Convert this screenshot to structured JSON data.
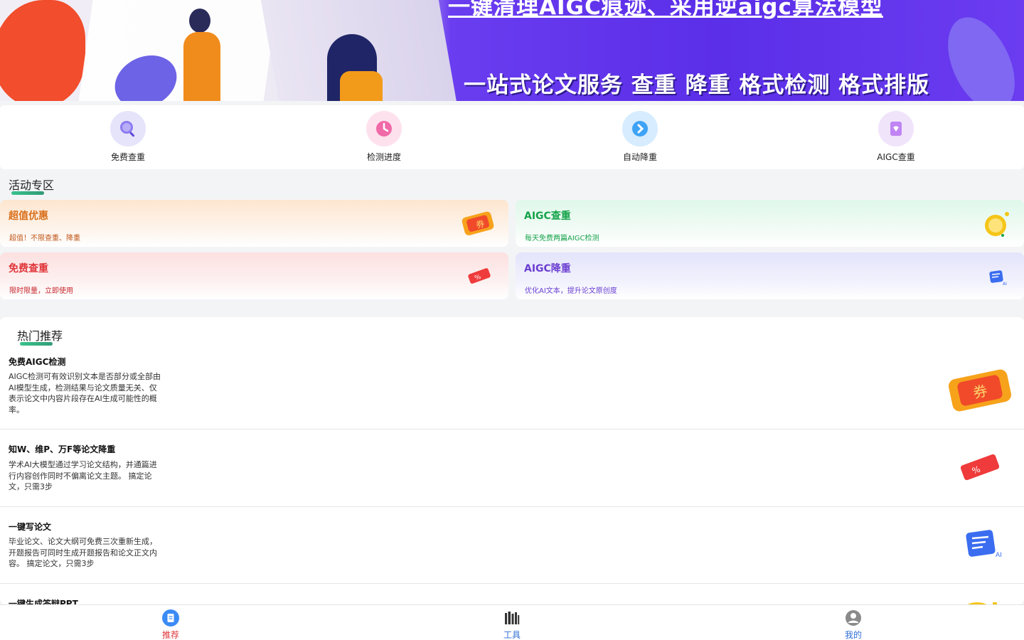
{
  "banner": {
    "headline": "一键清理AIGC痕迹、采用逆aigc算法模型",
    "subline": "一站式论文服务 查重 降重 格式检测 格式排版"
  },
  "quick_menu": [
    {
      "label": "免费查重",
      "icon": "search-icon",
      "color": "#e8e6fb"
    },
    {
      "label": "检测进度",
      "icon": "clock-icon",
      "color": "#fde3ef"
    },
    {
      "label": "自动降重",
      "icon": "gear-icon",
      "color": "#dcefff"
    },
    {
      "label": "AIGC查重",
      "icon": "document-icon",
      "color": "#f1e6fb"
    }
  ],
  "activity": {
    "title": "活动专区",
    "cards": [
      {
        "title": "超值优惠",
        "desc": "超值！不限查重、降重",
        "icon": "ticket-icon",
        "color": "#d9701c"
      },
      {
        "title": "AIGC查重",
        "desc": "每天免费两篇AIGC检测",
        "icon": "coin-icon",
        "color": "#16a34a"
      },
      {
        "title": "免费查重",
        "desc": "限时限量，立即使用",
        "icon": "coupon-icon",
        "color": "#e0363a"
      },
      {
        "title": "AIGC降重",
        "desc": "优化AI文本，提升论文原创度",
        "icon": "ai-doc-icon",
        "color": "#6b3fd1"
      }
    ]
  },
  "recommend": {
    "title": "热门推荐",
    "items": [
      {
        "title": "免费AIGC检测",
        "desc": "AIGC检测可有效识别文本是否部分或全部由AI模型生成，检测结果与论文质量无关、仅表示论文中内容片段存在AI生成可能性的概率。",
        "icon": "ticket-icon"
      },
      {
        "title": "知W、维P、万F等论文降重",
        "desc": "学术AI大模型通过学习论文结构，并通篇进行内容创作同时不偏离论文主题。 搞定论文，只需3步",
        "icon": "coupon-icon"
      },
      {
        "title": "一键写论文",
        "desc": "毕业论文、论文大纲可免费三次重新生成，开题报告可同时生成开题报告和论文正文内容。 搞定论文，只需3步",
        "icon": "ai-doc-icon"
      },
      {
        "title": "一键生成答辩PPT",
        "desc": "",
        "icon": "coin-icon"
      }
    ]
  },
  "tabbar": {
    "active_color": "#e0363a",
    "inactive_color": "#2f6fd6",
    "tabs": [
      {
        "label": "推荐",
        "icon": "recommend-icon",
        "active": true
      },
      {
        "label": "工具",
        "icon": "tools-icon",
        "active": false
      },
      {
        "label": "我的",
        "icon": "profile-icon",
        "active": false
      }
    ]
  }
}
